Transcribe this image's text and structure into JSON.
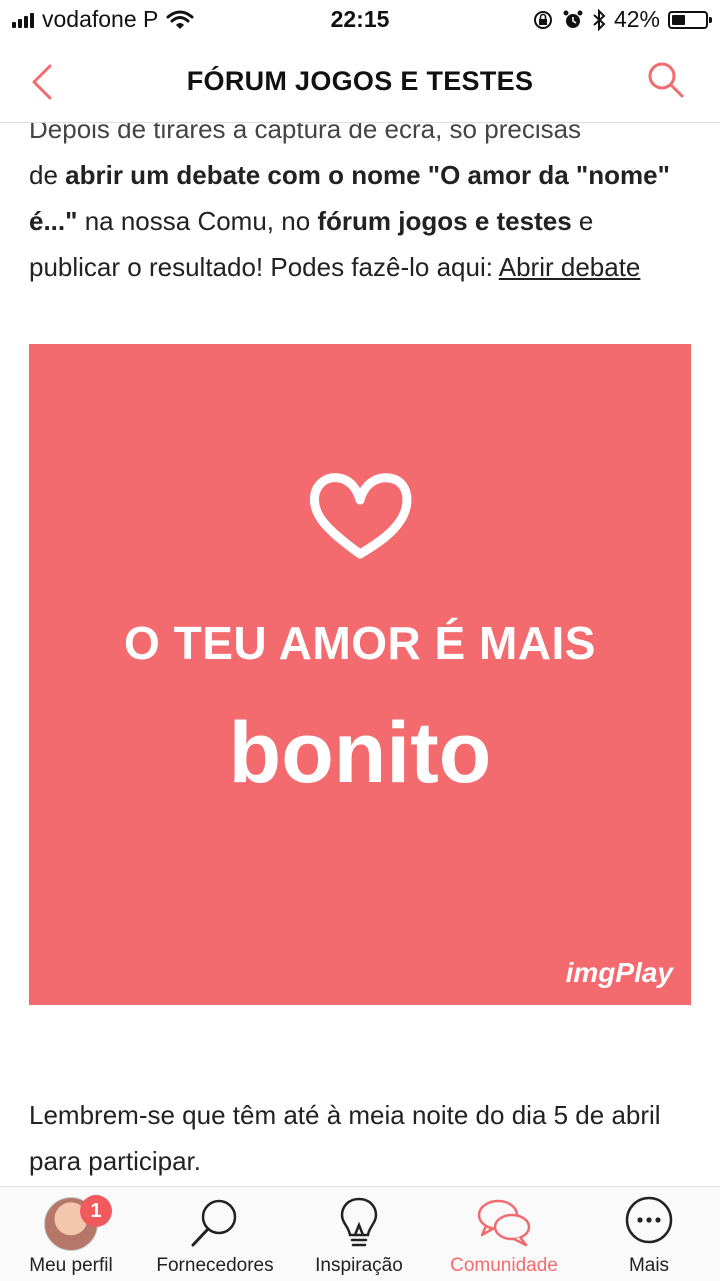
{
  "status_bar": {
    "carrier": "vodafone P",
    "time": "22:15",
    "battery": "42%",
    "battery_level": 0.42
  },
  "nav": {
    "title": "FÓRUM JOGOS E TESTES",
    "back_icon": "chevron-left-icon",
    "search_icon": "search-icon",
    "accent_color": "#f36b6e"
  },
  "article": {
    "cut_line": "Depois de tirares a captura de ecrã, só precisas",
    "p1_a": "de ",
    "p1_b": "abrir um debate com o nome \"O amor da \"nome\" é...\"",
    "p1_c": " na nossa Comu, no ",
    "p1_d": "fórum jogos e testes",
    "p1_e": " e publicar o resultado! Podes fazê-lo aqui: ",
    "link": "Abrir debate"
  },
  "promo": {
    "line1": "O TEU AMOR É MAIS",
    "line2": "bonito",
    "brand": "imgPlay",
    "background": "#f36b6e"
  },
  "note": "Lembrem-se que têm até à meia noite do dia 5 de abril para participar.",
  "tabbar": {
    "items": [
      {
        "label": "Meu perfil",
        "icon": "avatar",
        "badge": "1"
      },
      {
        "label": "Fornecedores",
        "icon": "search-icon"
      },
      {
        "label": "Inspiração",
        "icon": "lightbulb-icon"
      },
      {
        "label": "Comunidade",
        "icon": "chat-bubbles-icon",
        "active": true
      },
      {
        "label": "Mais",
        "icon": "more-icon"
      }
    ]
  }
}
